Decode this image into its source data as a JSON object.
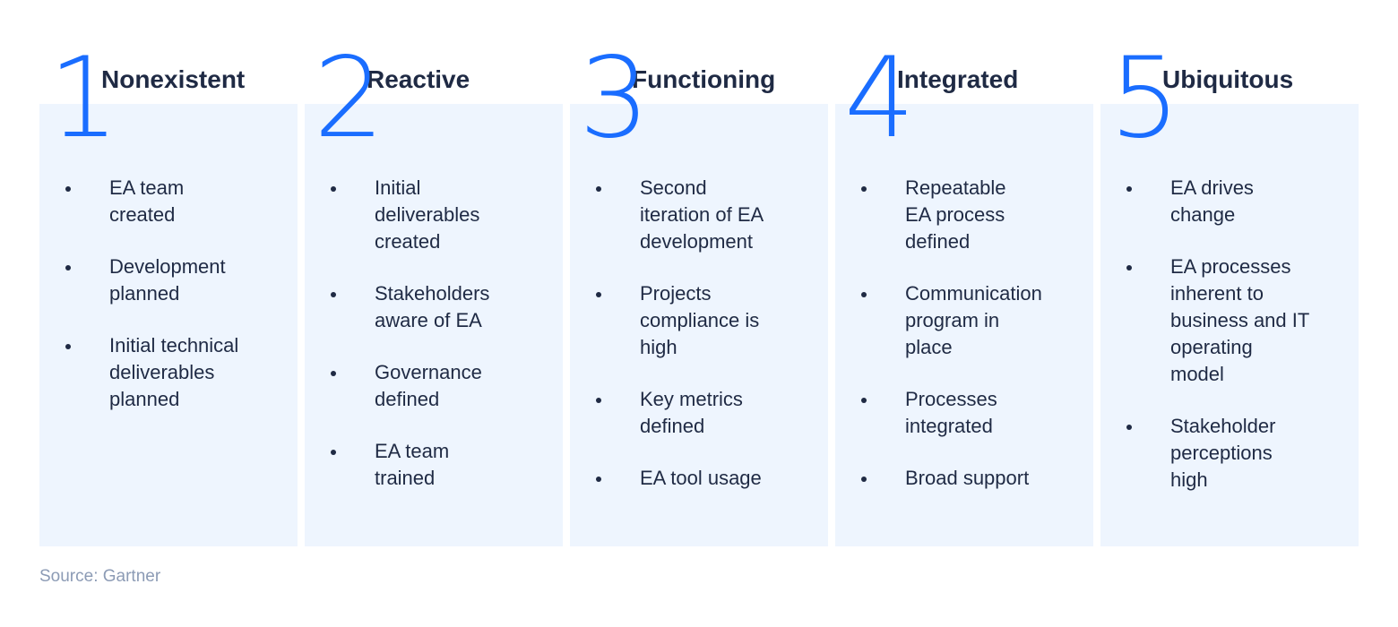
{
  "accent_color": "#1a6dff",
  "panel_color": "#eef5fe",
  "stages": [
    {
      "number": "1",
      "title": "Nonexistent",
      "items": [
        "EA team\ncreated",
        "Development\nplanned",
        "Initial technical\ndeliverables\nplanned"
      ]
    },
    {
      "number": "2",
      "title": "Reactive",
      "items": [
        "Initial\ndeliverables\ncreated",
        "Stakeholders\naware of EA",
        "Governance\ndefined",
        "EA team\ntrained"
      ]
    },
    {
      "number": "3",
      "title": "Functioning",
      "items": [
        "Second\niteration of EA\ndevelopment",
        "Projects\ncompliance is\nhigh",
        "Key metrics\ndefined",
        "EA tool usage"
      ]
    },
    {
      "number": "4",
      "title": "Integrated",
      "items": [
        "Repeatable\nEA process\ndefined",
        "Communication\nprogram in\nplace",
        "Processes\nintegrated",
        "Broad support"
      ]
    },
    {
      "number": "5",
      "title": "Ubiquitous",
      "items": [
        "EA drives\nchange",
        "EA processes\ninherent to\nbusiness and IT\noperating\nmodel",
        "Stakeholder\nperceptions\nhigh"
      ]
    }
  ],
  "source": "Source: Gartner"
}
